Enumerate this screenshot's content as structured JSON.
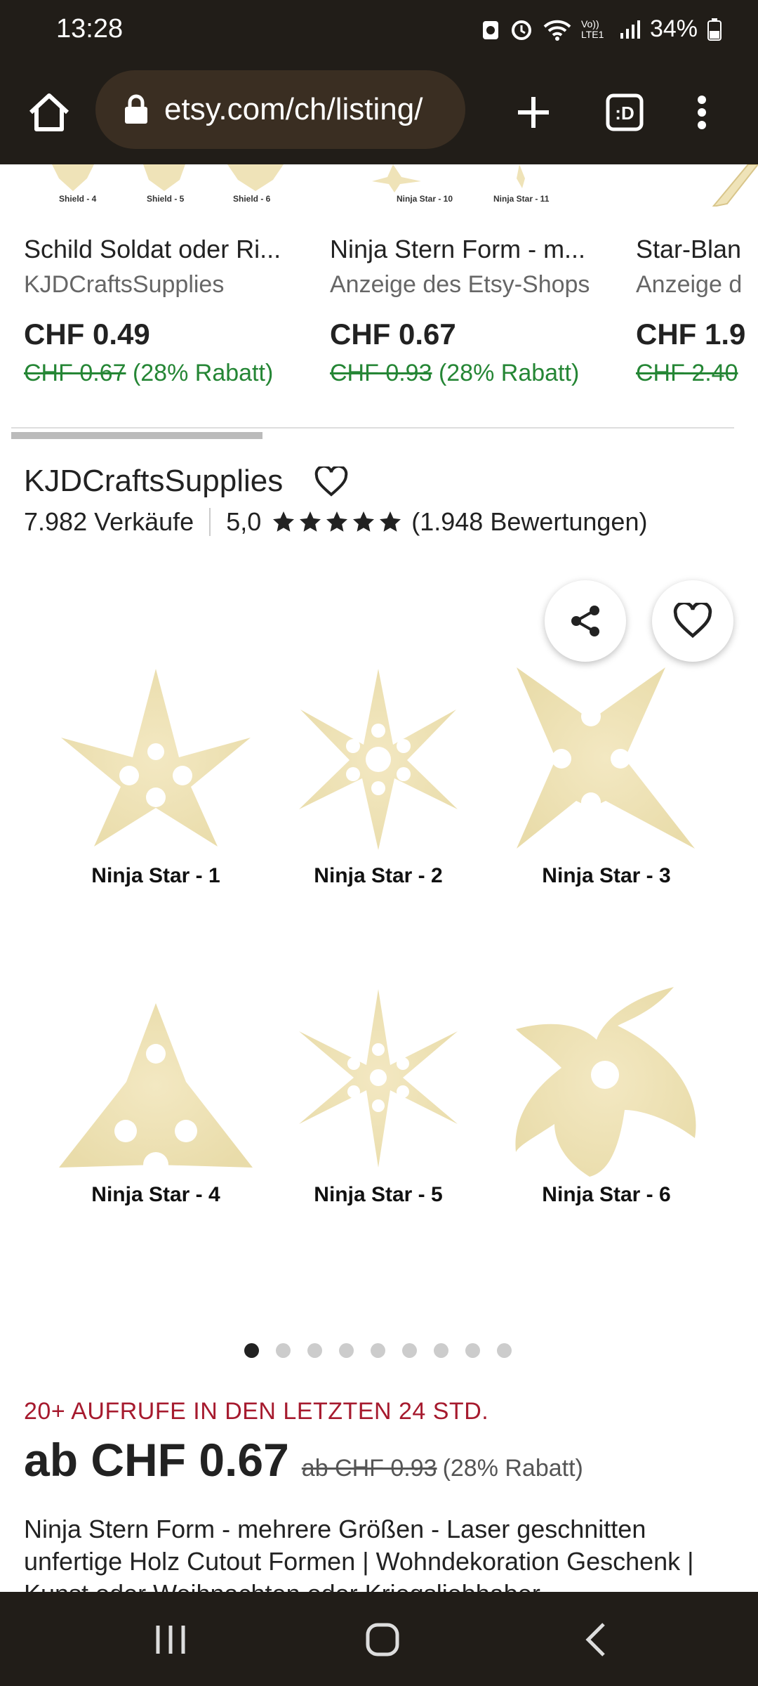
{
  "status_bar": {
    "time": "13:28",
    "network": "Vo)) LTE1",
    "battery": "34%"
  },
  "browser": {
    "url": "etsy.com/ch/listing/"
  },
  "related_items": [
    {
      "thumb_captions": [
        "Shield - 4",
        "Shield - 5",
        "Shield - 6"
      ],
      "title": "Schild Soldat oder Ri...",
      "shop": "KJDCraftsSupplies",
      "price": "CHF 0.49",
      "old_price": "CHF 0.67",
      "discount": "(28% Rabatt)"
    },
    {
      "thumb_captions": [
        "Ninja Star - 10",
        "Ninja Star - 11"
      ],
      "title": "Ninja Stern Form - m...",
      "shop": "Anzeige des Etsy-Shops",
      "price": "CHF 0.67",
      "old_price": "CHF 0.93",
      "discount": "(28% Rabatt)"
    },
    {
      "thumb_captions": [],
      "title": "Star-Blan",
      "shop": "Anzeige d",
      "price": "CHF 1.9",
      "old_price": "CHF 2.40",
      "discount": ""
    }
  ],
  "shop": {
    "name": "KJDCraftsSupplies",
    "sales": "7.982 Verkäufe",
    "rating": "5,0",
    "stars": 5,
    "reviews": "(1.948 Bewertungen)"
  },
  "gallery": {
    "labels": [
      "Ninja Star - 1",
      "Ninja Star - 2",
      "Ninja Star - 3",
      "Ninja Star - 4",
      "Ninja Star - 5",
      "Ninja Star - 6"
    ],
    "image_count": 9,
    "active_index": 0
  },
  "listing": {
    "views": "20+ AUFRUFE IN DEN LETZTEN 24 STD.",
    "price": "ab CHF 0.67",
    "old_price": "ab CHF 0.93",
    "discount": "(28% Rabatt)",
    "title": "Ninja Stern Form - mehrere Größen - Laser geschnitten unfertige Holz Cutout Formen | Wohndekoration Geschenk | Kunst oder Weihnachten oder Kriegsliebhaber"
  },
  "colors": {
    "topbar": "#211d18",
    "urlbar": "#3a2e22",
    "discount_green": "#258635",
    "views_red": "#a61a2e",
    "wood": "#efe3b8"
  }
}
